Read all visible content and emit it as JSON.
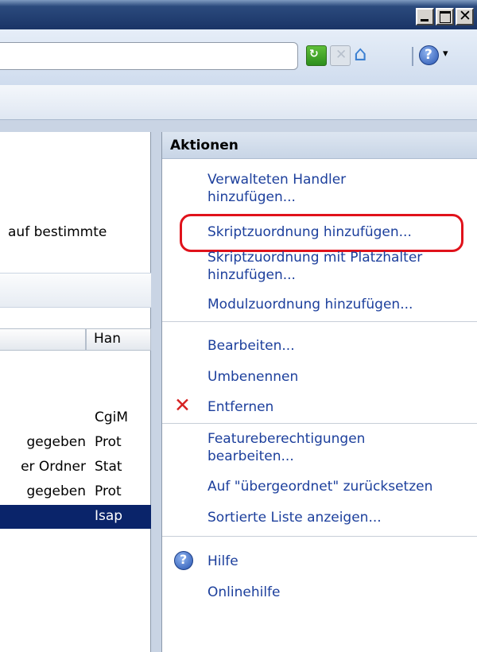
{
  "window": {
    "buttons": [
      "minimize",
      "maximize",
      "close"
    ],
    "close_glyph": "✕"
  },
  "toolbar": {
    "address_value": "",
    "icons": [
      "refresh-icon",
      "stop-icon",
      "home-icon",
      "help-icon",
      "dropdown-arrow-icon"
    ],
    "refresh_glyph": "↻",
    "stop_glyph": "✕",
    "home_glyph": "⌂",
    "help_glyph": "?",
    "dropdown_glyph": "▾"
  },
  "left_pane": {
    "description_fragment": "auf bestimmte",
    "column_header_b": "Han",
    "rows": [
      {
        "c1": "",
        "c2": "CgiM"
      },
      {
        "c1": "gegeben",
        "c2": "Prot"
      },
      {
        "c1": "er Ordner",
        "c2": "Stat"
      },
      {
        "c1": "gegeben",
        "c2": "Prot"
      },
      {
        "c1": "",
        "c2": "Isap",
        "selected": true
      }
    ]
  },
  "actions": {
    "header": "Aktionen",
    "items": [
      {
        "label": "Verwalteten Handler hinzufügen..."
      },
      {
        "label": "Skriptzuordnung hinzufügen...",
        "highlighted": true
      },
      {
        "label": "Skriptzuordnung mit Platzhalter hinzufügen..."
      },
      {
        "label": "Modulzuordnung hinzufügen..."
      },
      {
        "label": "Bearbeiten..."
      },
      {
        "label": "Umbenennen"
      },
      {
        "label": "Entfernen",
        "icon": "remove-x-icon"
      },
      {
        "label": "Featureberechtigungen bearbeiten..."
      },
      {
        "label": "Auf \"übergeordnet\" zurücksetzen"
      },
      {
        "label": "Sortierte Liste anzeigen..."
      },
      {
        "label": "Hilfe",
        "icon": "help-icon"
      },
      {
        "label": "Onlinehilfe"
      }
    ],
    "label_line1": {
      "0": "Verwalteten Handler",
      "0b": "hinzufügen...",
      "2": "Skriptzuordnung mit Platzhalter",
      "2b": "hinzufügen...",
      "7": "Featureberechtigungen",
      "7b": "bearbeiten..."
    },
    "x_glyph": "✕",
    "help_glyph": "?",
    "highlight_color": "#e0121b"
  },
  "colors": {
    "link": "#1c3f9c",
    "selected_row": "#0a246a",
    "desktop": "#324c74"
  }
}
